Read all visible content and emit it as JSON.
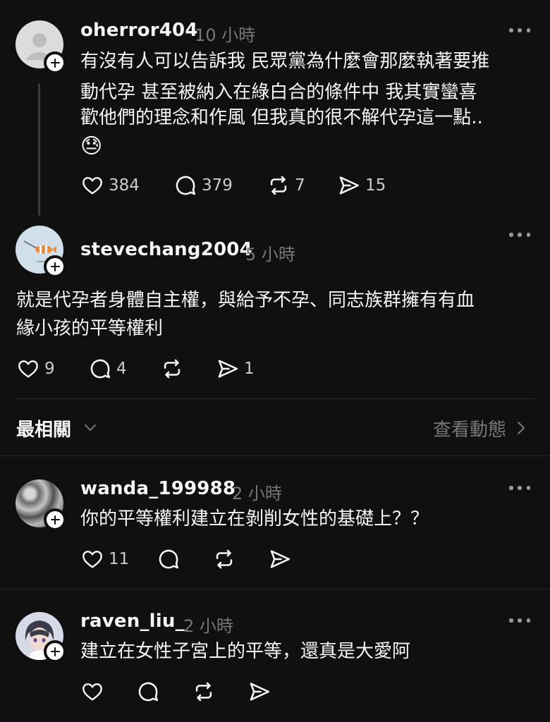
{
  "post": {
    "username": "oherror404",
    "time": "10 小時",
    "lines": [
      "有沒有人可以告訴我 民眾黨為什麼會那麼執著要推",
      "動代孕 甚至被納入在綠白合的條件中 我其實蠻喜",
      "歡他們的理念和作風 但我真的很不解代孕這一點.."
    ],
    "emoji": "😓",
    "likes": "384",
    "replies": "379",
    "reposts": "7",
    "shares": "15"
  },
  "reply1": {
    "username": "stevechang2004",
    "time": "5 小時",
    "lines": [
      "就是代孕者身體自主權，與給予不孕、同志族群擁有有血",
      "緣小孩的平等權利"
    ],
    "likes": "9",
    "replies": "4",
    "reposts": "",
    "shares": "1"
  },
  "sort_bar": {
    "label": "最相關",
    "view_activity": "查看動態"
  },
  "comment1": {
    "username": "wanda_199988",
    "time": "2 小時",
    "text": "你的平等權利建立在剝削女性的基礎上？？",
    "likes": "11"
  },
  "comment2": {
    "username": "raven_liu_",
    "time": "2 小時",
    "text": "建立在女性子宮上的平等，還真是大愛阿"
  },
  "icons": {
    "like": "heart-icon",
    "reply": "comment-bubble-icon",
    "repost": "repost-arrows-icon",
    "share": "send-icon",
    "more": "ellipsis-icon",
    "follow": "plus-icon"
  },
  "colors": {
    "background": "#101010",
    "text": "#f3f5f7",
    "secondary": "#777777",
    "divider": "#2a2a2a"
  }
}
